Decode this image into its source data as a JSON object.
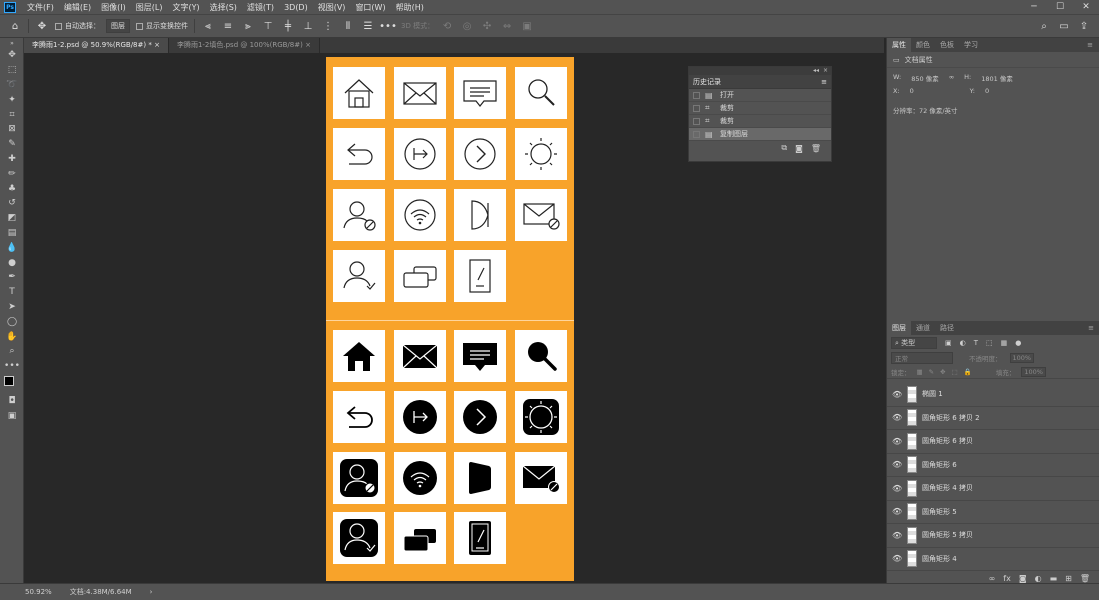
{
  "menubar": {
    "items": [
      "文件(F)",
      "编辑(E)",
      "图像(I)",
      "图层(L)",
      "文字(Y)",
      "选择(S)",
      "滤镜(T)",
      "3D(D)",
      "视图(V)",
      "窗口(W)",
      "帮助(H)"
    ],
    "logo": "Ps"
  },
  "options": {
    "auto_select_label": "自动选择：",
    "auto_select_value": "图层",
    "show_transform_label": "显示变换控件",
    "mode_3d_label": "3D 模式："
  },
  "tabs": [
    {
      "label": "李腾雨1-2.psd @ 50.9%(RGB/8#) *",
      "active": true
    },
    {
      "label": "李腾雨1-2填色.psd @ 100%(RGB/8#)",
      "active": false
    }
  ],
  "history": {
    "title": "历史记录",
    "items": [
      {
        "label": "打开",
        "icon": "document-icon"
      },
      {
        "label": "裁剪",
        "icon": "crop-icon"
      },
      {
        "label": "裁剪",
        "icon": "crop-icon"
      },
      {
        "label": "复制图层",
        "icon": "document-icon",
        "selected": true
      }
    ]
  },
  "properties": {
    "tabs": [
      "属性",
      "颜色",
      "色板",
      "学习"
    ],
    "doc_title": "文档属性",
    "w_label": "W:",
    "w_value": "850 像素",
    "h_label": "H:",
    "h_value": "1801 像素",
    "x_label": "X:",
    "x_value": "0",
    "y_label": "Y:",
    "y_value": "0",
    "resolution": "分辨率：72 像素/英寸"
  },
  "layers_panel": {
    "tabs": [
      "图层",
      "通道",
      "路径"
    ],
    "filter_label": "类型",
    "blend_mode": "正常",
    "opacity_label": "不透明度：",
    "opacity_value": "100%",
    "lock_label": "锁定：",
    "fill_label": "填充：",
    "fill_value": "100%",
    "layers": [
      "椭圆 1",
      "圆角矩形 6 拷贝 2",
      "圆角矩形 6 拷贝",
      "圆角矩形 6",
      "圆角矩形 4 拷贝",
      "圆角矩形 5",
      "圆角矩形 5 拷贝",
      "圆角矩形 4"
    ]
  },
  "status": {
    "zoom": "50.92%",
    "doc_size": "文档:4.38M/6.64M"
  },
  "icons_grid": {
    "outline": [
      "home-icon",
      "mail-icon",
      "chat-icon",
      "search-icon",
      "back-arrow-icon",
      "exit-icon",
      "next-icon",
      "sun-icon",
      "user-block-icon",
      "wifi-icon",
      "door-icon",
      "mail-block-icon",
      "user-check-icon",
      "cards-icon",
      "tablet-icon"
    ],
    "filled": [
      "home-icon",
      "mail-icon",
      "chat-icon",
      "search-icon",
      "back-arrow-icon",
      "exit-icon",
      "next-icon",
      "sun-icon",
      "user-block-icon",
      "wifi-icon",
      "door-icon",
      "mail-block-icon",
      "user-check-icon",
      "cards-icon",
      "tablet-icon"
    ]
  },
  "colors": {
    "artboard": "#f8a32a",
    "ui_gray": "#535353",
    "canvas": "#282828"
  }
}
